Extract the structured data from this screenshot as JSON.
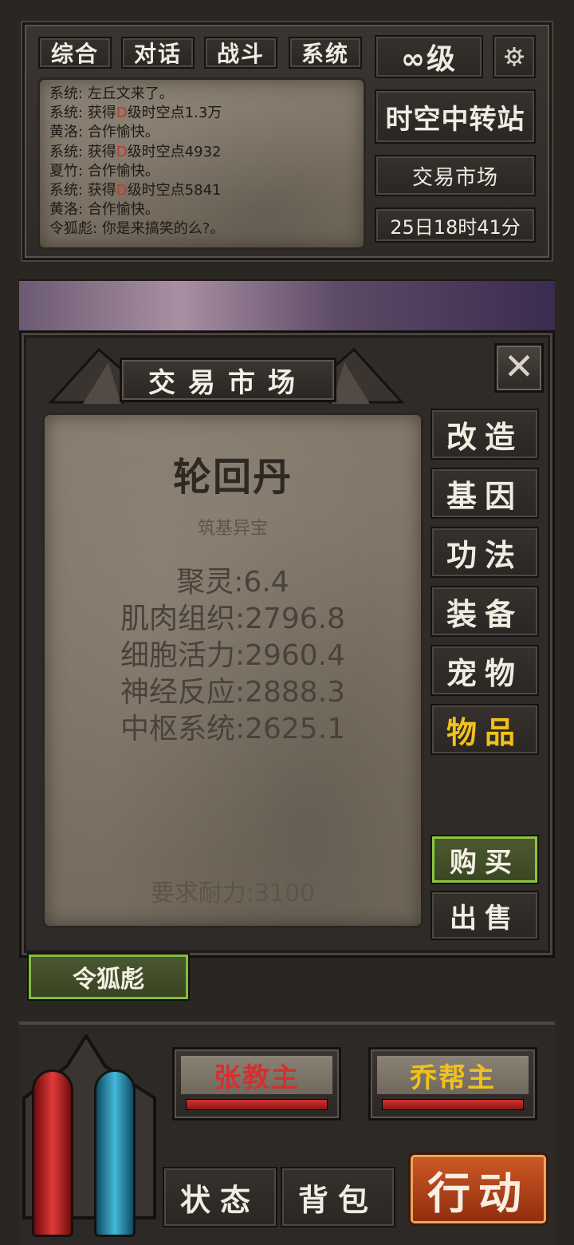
{
  "chat": {
    "tabs": [
      "综合",
      "对话",
      "战斗",
      "系统"
    ],
    "lines": [
      {
        "speaker": "系统:",
        "pre": "左丘文来了。",
        "hl": "",
        "post": ""
      },
      {
        "speaker": "系统:",
        "pre": "获得",
        "hl": "D",
        "post": "级时空点1.3万"
      },
      {
        "speaker": "黄洛:",
        "pre": "合作愉快。",
        "hl": "",
        "post": ""
      },
      {
        "speaker": "系统:",
        "pre": "获得",
        "hl": "D",
        "post": "级时空点4932"
      },
      {
        "speaker": "夏竹:",
        "pre": "合作愉快。",
        "hl": "",
        "post": ""
      },
      {
        "speaker": "系统:",
        "pre": "获得",
        "hl": "D",
        "post": "级时空点5841"
      },
      {
        "speaker": "黄洛:",
        "pre": "合作愉快。",
        "hl": "",
        "post": ""
      },
      {
        "speaker": "令狐彪:",
        "pre": "你是来搞笑的么?。",
        "hl": "",
        "post": ""
      }
    ]
  },
  "status": {
    "level": "∞级",
    "location": "时空中转站",
    "market_link": "交易市场",
    "time": "25日18时41分"
  },
  "market": {
    "title": "交易市场",
    "close": "✕",
    "item": {
      "name": "轮回丹",
      "type": "筑基异宝",
      "stats": [
        "聚灵:6.4",
        "肌肉组织:2796.8",
        "细胞活力:2960.4",
        "神经反应:2888.3",
        "中枢系统:2625.1"
      ],
      "requirement": "要求耐力:3100"
    },
    "categories": [
      "改造",
      "基因",
      "功法",
      "装备",
      "宠物",
      "物品"
    ],
    "active_category": "物品",
    "buy": "购买",
    "sell": "出售"
  },
  "target": "令狐彪",
  "bosses": [
    {
      "name": "张教主",
      "color": "#d62f2f",
      "hp": 1.0
    },
    {
      "name": "乔帮主",
      "color": "#f2c21a",
      "hp": 1.0
    }
  ],
  "bottom": {
    "status_tab": "状态",
    "bag_tab": "背包",
    "action": "行动"
  },
  "icons": {
    "settings": "gear-icon",
    "close": "close-icon"
  }
}
